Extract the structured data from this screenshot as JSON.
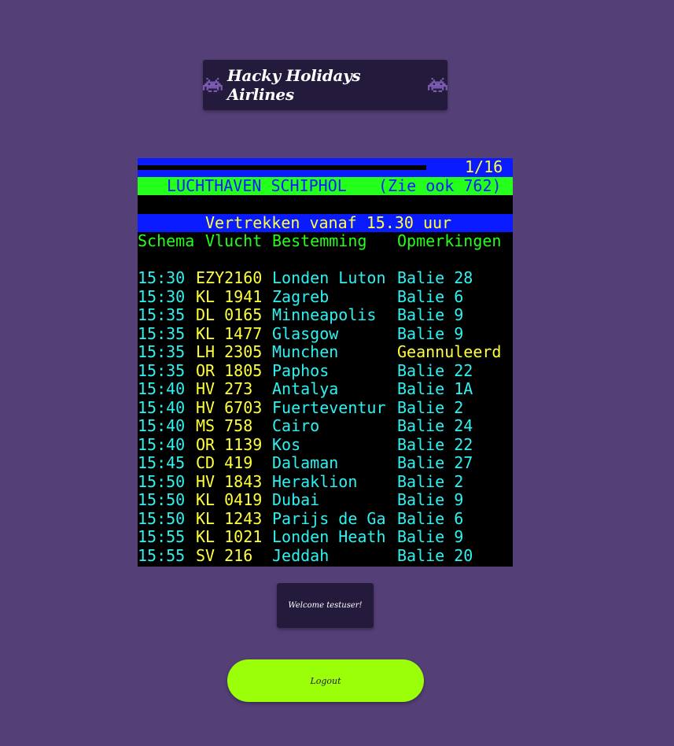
{
  "header": {
    "title": "Hacky Holidays Airlines",
    "left_icon": "space-invader-icon",
    "right_icon": "space-invader-icon"
  },
  "teletext": {
    "page_indicator": "1/16",
    "airport_title": "LUCHTHAVEN SCHIPHOL",
    "see_also": "(Zie ook 762)",
    "departures_heading": "Vertrekken vanaf 15.30 uur",
    "columns": [
      "Schema",
      "Vlucht",
      "Bestemming",
      "Opmerkingen"
    ],
    "flights": [
      {
        "time": "15:30",
        "flight": "EZY2160",
        "destination": "Londen Luton",
        "remark": "Balie 28"
      },
      {
        "time": "15:30",
        "flight": "KL 1941",
        "destination": "Zagreb",
        "remark": "Balie 6"
      },
      {
        "time": "15:35",
        "flight": "DL 0165",
        "destination": "Minneapolis",
        "remark": "Balie 9"
      },
      {
        "time": "15:35",
        "flight": "KL 1477",
        "destination": "Glasgow",
        "remark": "Balie 9"
      },
      {
        "time": "15:35",
        "flight": "LH 2305",
        "destination": "Munchen",
        "remark": "Geannuleerd"
      },
      {
        "time": "15:35",
        "flight": "OR 1805",
        "destination": "Paphos",
        "remark": "Balie 22"
      },
      {
        "time": "15:40",
        "flight": "HV 273",
        "destination": "Antalya",
        "remark": "Balie 1A"
      },
      {
        "time": "15:40",
        "flight": "HV 6703",
        "destination": "Fuerteventur",
        "remark": "Balie 2"
      },
      {
        "time": "15:40",
        "flight": "MS 758",
        "destination": "Cairo",
        "remark": "Balie 24"
      },
      {
        "time": "15:40",
        "flight": "OR 1139",
        "destination": "Kos",
        "remark": "Balie 22"
      },
      {
        "time": "15:45",
        "flight": "CD 419",
        "destination": "Dalaman",
        "remark": "Balie 27"
      },
      {
        "time": "15:50",
        "flight": "HV 1843",
        "destination": "Heraklion",
        "remark": "Balie 2"
      },
      {
        "time": "15:50",
        "flight": "KL 0419",
        "destination": "Dubai",
        "remark": "Balie 9"
      },
      {
        "time": "15:50",
        "flight": "KL 1243",
        "destination": "Parijs de Ga",
        "remark": "Balie 6"
      },
      {
        "time": "15:55",
        "flight": "KL 1021",
        "destination": "Londen Heath",
        "remark": "Balie 9"
      },
      {
        "time": "15:55",
        "flight": "SV 216",
        "destination": "Jeddah",
        "remark": "Balie 20"
      }
    ]
  },
  "welcome": {
    "text": "Welcome testuser!"
  },
  "logout": {
    "label": "Logout"
  },
  "colors": {
    "background": "#553f77",
    "panel": "#231a3c",
    "teletext_yellow": "#ffff3c",
    "teletext_cyan": "#2ef2f2",
    "teletext_green": "#24ff1c",
    "teletext_blue": "#0a1cff",
    "logout_button": "#9bff0a",
    "cancelled_remark": "#ffff3c"
  }
}
